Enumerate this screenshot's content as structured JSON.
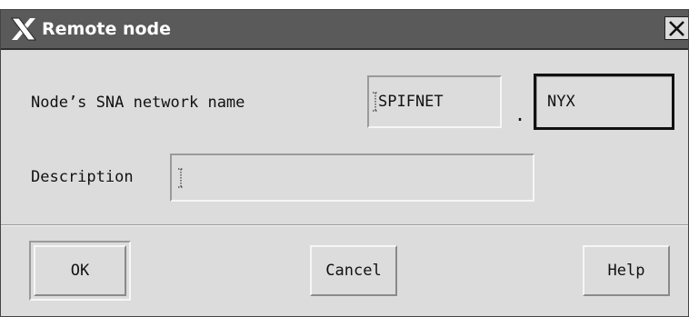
{
  "window": {
    "title": "Remote node"
  },
  "form": {
    "network_name_label": "Node’s SNA network name",
    "network_name_value": "SPIFNET",
    "separator": ".",
    "node_name_value": "NYX",
    "description_label": "Description",
    "description_value": ""
  },
  "buttons": {
    "ok": "OK",
    "cancel": "Cancel",
    "help": "Help"
  }
}
